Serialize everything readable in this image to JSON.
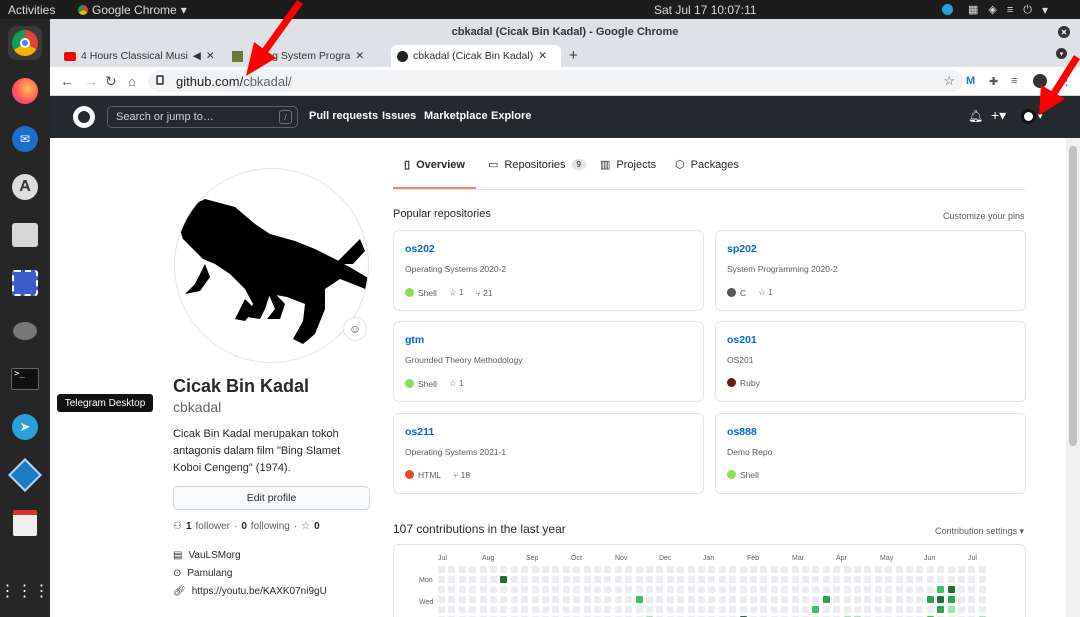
{
  "system": {
    "activities": "Activities",
    "app_menu": "Google Chrome",
    "clock": "Sat Jul 17  10:07:11",
    "tooltip": "Telegram Desktop"
  },
  "window": {
    "title": "cbkadal (Cicak Bin Kadal) - Google Chrome"
  },
  "tabs": [
    {
      "label": "4 Hours Classical Musi"
    },
    {
      "label": "ing System Progra"
    },
    {
      "label": "cbkadal (Cicak Bin Kadal)"
    }
  ],
  "omnibox": {
    "url_host": "github.com/",
    "url_path": "cbkadal/"
  },
  "gh_header": {
    "search_placeholder": "Search or jump to…",
    "search_key": "/",
    "nav": [
      "Pull requests",
      "Issues",
      "Marketplace",
      "Explore"
    ]
  },
  "profile_tabs": [
    {
      "label": "Overview"
    },
    {
      "label": "Repositories",
      "count": "9"
    },
    {
      "label": "Projects"
    },
    {
      "label": "Packages"
    }
  ],
  "profile": {
    "name": "Cicak Bin Kadal",
    "login": "cbkadal",
    "bio": "Cicak Bin Kadal merupakan tokoh antagonis dalam film \"Bing Slamet Koboi Cengeng\" (1974).",
    "edit_label": "Edit profile",
    "followers": "1",
    "followers_label": "follower",
    "following": "0",
    "following_label": "following",
    "stars": "0",
    "org": "VauLSMorg",
    "location": "Pamulang",
    "link": "https://youtu.be/KAXK07ni9gU"
  },
  "popular": {
    "title": "Popular repositories",
    "customize": "Customize your pins",
    "repos": [
      {
        "name": "os202",
        "desc": "Operating Systems 2020-2",
        "lang": "Shell",
        "lang_color": "#89e051",
        "stars": "1",
        "forks": "21"
      },
      {
        "name": "sp202",
        "desc": "System Programming 2020-2",
        "lang": "C",
        "lang_color": "#555555",
        "stars": "1",
        "forks": ""
      },
      {
        "name": "gtm",
        "desc": "Grounded Theory Methodology",
        "lang": "Shell",
        "lang_color": "#89e051",
        "stars": "1",
        "forks": ""
      },
      {
        "name": "os201",
        "desc": "OS201",
        "lang": "Ruby",
        "lang_color": "#701516",
        "stars": "",
        "forks": ""
      },
      {
        "name": "os211",
        "desc": "Operating Systems 2021-1",
        "lang": "HTML",
        "lang_color": "#e34c26",
        "stars": "",
        "forks": "18"
      },
      {
        "name": "os888",
        "desc": "Demo Repo",
        "lang": "Shell",
        "lang_color": "#89e051",
        "stars": "",
        "forks": ""
      }
    ]
  },
  "contributions": {
    "title": "107 contributions in the last year",
    "settings": "Contribution settings ▾",
    "months": [
      "Jul",
      "Aug",
      "Sep",
      "Oct",
      "Nov",
      "Dec",
      "Jan",
      "Feb",
      "Mar",
      "Apr",
      "May",
      "Jun",
      "Jul"
    ],
    "days": [
      "Mon",
      "Wed"
    ],
    "levels_colors": [
      "#ebedf0",
      "#9be9a8",
      "#40c463",
      "#30a14e",
      "#216e39"
    ]
  },
  "colors": {
    "gh_header": "#24292e",
    "link": "#0366d6",
    "tab_underline": "#f9826c",
    "annotation_arrow": "#ff0000"
  }
}
